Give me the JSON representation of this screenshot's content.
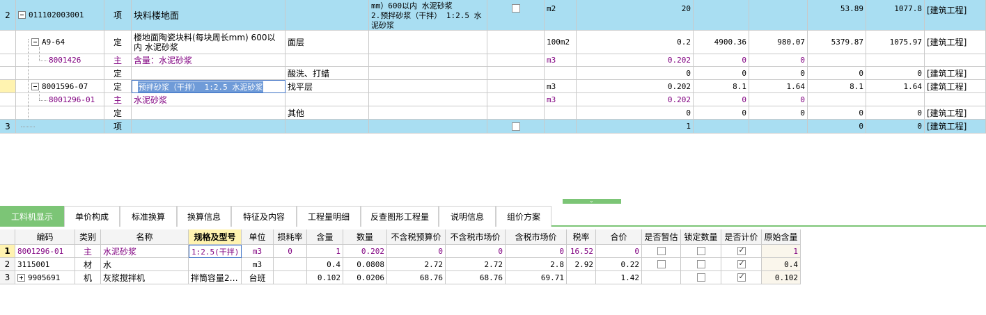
{
  "upper": {
    "row2": {
      "num": "2",
      "code": "011102003001",
      "type": "项",
      "name": "块料楼地面",
      "feature_line1": "mm）600以内 水泥砂浆",
      "feature_line2": "2.预拌砂浆（干拌） 1:2.5 水",
      "feature_line3": "泥砂浆",
      "unit": "m2",
      "qty": "20",
      "unit_price": "53.89",
      "total": "1077.8",
      "prof": "[建筑工程]"
    },
    "a964": {
      "code": "A9-64",
      "type": "定",
      "name": "楼地面陶瓷块料(每块周长mm) 600以内 水泥砂浆",
      "work": "面层",
      "unit": "100m2",
      "qty": "0.2",
      "p1": "4900.36",
      "p2": "980.07",
      "p3": "5379.87",
      "p4": "1075.97",
      "prof": "[建筑工程]"
    },
    "m8001426": {
      "code": "8001426",
      "type": "主",
      "name": "含量：水泥砂浆",
      "unit": "m3",
      "qty": "0.202",
      "p1": "0",
      "p2": "0"
    },
    "acid": {
      "type": "定",
      "work": "酸洗、打蜡",
      "qty": "0",
      "p1": "0",
      "p2": "0",
      "p3": "0",
      "p4": "0",
      "prof": "[建筑工程]"
    },
    "d8001596": {
      "code": "8001596-07",
      "type": "定",
      "name": "预拌砂浆（干拌） 1:2.5 水泥砂浆",
      "work": "找平层",
      "unit": "m3",
      "qty": "0.202",
      "p1": "8.1",
      "p2": "1.64",
      "p3": "8.1",
      "p4": "1.64",
      "prof": "[建筑工程]"
    },
    "m8001296": {
      "code": "8001296-01",
      "type": "主",
      "name": "水泥砂浆",
      "unit": "m3",
      "qty": "0.202",
      "p1": "0",
      "p2": "0"
    },
    "other": {
      "type": "定",
      "work": "其他",
      "qty": "0",
      "p1": "0",
      "p2": "0",
      "p3": "0",
      "p4": "0",
      "prof": "[建筑工程]"
    },
    "row3": {
      "num": "3",
      "type": "项",
      "qty": "1",
      "p3": "0",
      "p4": "0",
      "prof": "[建筑工程]"
    }
  },
  "tabs": [
    {
      "label": "工料机显示"
    },
    {
      "label": "单价构成"
    },
    {
      "label": "标准换算"
    },
    {
      "label": "换算信息"
    },
    {
      "label": "特征及内容"
    },
    {
      "label": "工程量明细"
    },
    {
      "label": "反查图形工程量"
    },
    {
      "label": "说明信息"
    },
    {
      "label": "组价方案"
    }
  ],
  "lower": {
    "headers": [
      "编码",
      "类别",
      "名称",
      "规格及型号",
      "单位",
      "损耗率",
      "含量",
      "数量",
      "不含税预算价",
      "不含税市场价",
      "含税市场价",
      "税率",
      "合价",
      "是否暂估",
      "锁定数量",
      "是否计价",
      "原始含量"
    ],
    "rows": [
      {
        "num": "1",
        "code": "8001296-01",
        "cat": "主",
        "name": "水泥砂浆",
        "spec": "1:2.5(干拌)",
        "unit": "m3",
        "loss": "0",
        "content": "1",
        "qty": "0.202",
        "p1": "0",
        "p2": "0",
        "p3": "0",
        "tax": "16.52",
        "total": "0",
        "orig": "1"
      },
      {
        "num": "2",
        "code": "3115001",
        "cat": "材",
        "name": "水",
        "spec": "",
        "unit": "m3",
        "loss": "",
        "content": "0.4",
        "qty": "0.0808",
        "p1": "2.72",
        "p2": "2.72",
        "p3": "2.8",
        "tax": "2.92",
        "total": "0.22",
        "orig": "0.4"
      },
      {
        "num": "3",
        "code": "9905691",
        "cat": "机",
        "name": "灰浆搅拌机",
        "spec": "拌筒容量2…",
        "unit": "台班",
        "loss": "",
        "content": "0.102",
        "qty": "0.0206",
        "p1": "68.76",
        "p2": "68.76",
        "p3": "69.71",
        "tax": "",
        "total": "1.42",
        "orig": "0.102"
      }
    ]
  }
}
